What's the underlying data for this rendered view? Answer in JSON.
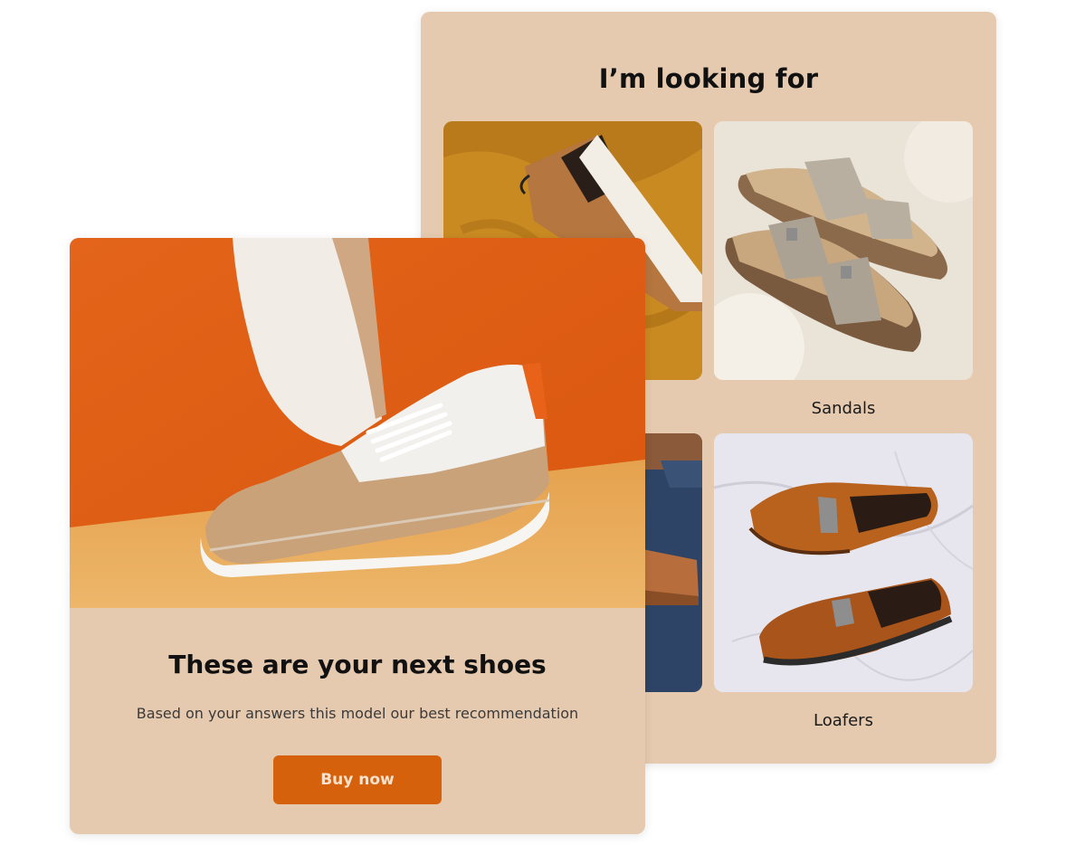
{
  "quiz": {
    "title": "I’m looking for",
    "options": [
      {
        "label": "",
        "image": "sneaker-on-mustard-fabric"
      },
      {
        "label": "Sandals",
        "image": "sandals-on-fur"
      },
      {
        "label": "",
        "image": "brown-shoes-on-denim"
      },
      {
        "label": "Loafers",
        "image": "loafers-on-marble"
      }
    ]
  },
  "result": {
    "image": "sneaker-on-orange-backdrop",
    "title": "These are your next shoes",
    "subtitle": "Based on your answers this model our best recommendation",
    "button_label": "Buy now"
  },
  "colors": {
    "card_background": "#E6CAAF",
    "accent": "#D5610D",
    "button_text": "#FBE2CC",
    "hero_orange": "#E0661B",
    "hero_floor": "#E9AE5E"
  }
}
